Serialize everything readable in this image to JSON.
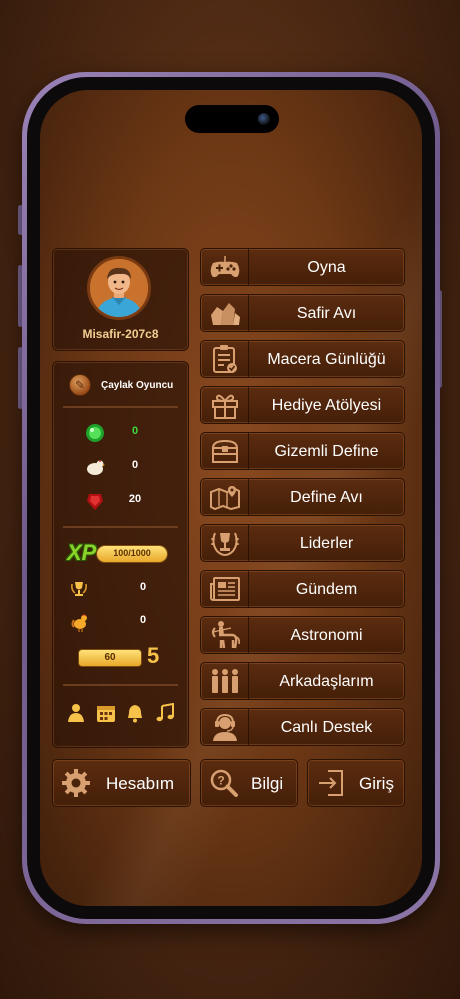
{
  "profile": {
    "username": "Misafir-207c8"
  },
  "stats": {
    "rank_label": "Çaylak Oyuncu",
    "resources": [
      {
        "icon": "green-gem-icon",
        "value": "0",
        "color": "#3ddc3d"
      },
      {
        "icon": "chicken-icon",
        "value": "0",
        "color": "#ffffff"
      },
      {
        "icon": "red-gem-icon",
        "value": "20",
        "color": "#ffffff"
      }
    ],
    "xp_label": "XP",
    "xp_text": "100/1000",
    "xp_progress": 0.1,
    "trophy_value": "0",
    "rooster_value": "0",
    "level_progress_text": "60",
    "level": "5"
  },
  "menu": [
    {
      "icon": "gamepad-icon",
      "label": "Oyna"
    },
    {
      "icon": "sapphire-rocks-icon",
      "label": "Safir Avı"
    },
    {
      "icon": "clipboard-icon",
      "label": "Macera Günlüğü"
    },
    {
      "icon": "gift-icon",
      "label": "Hediye Atölyesi"
    },
    {
      "icon": "treasure-chest-icon",
      "label": "Gizemli Define"
    },
    {
      "icon": "map-icon",
      "label": "Define Avı"
    },
    {
      "icon": "laurel-trophy-icon",
      "label": "Liderler"
    },
    {
      "icon": "newspaper-icon",
      "label": "Gündem"
    },
    {
      "icon": "centaur-archer-icon",
      "label": "Astronomi"
    },
    {
      "icon": "friends-icon",
      "label": "Arkadaşlarım"
    },
    {
      "icon": "headset-support-icon",
      "label": "Canlı Destek"
    }
  ],
  "bottom": {
    "account": "Hesabım",
    "info": "Bilgi",
    "login": "Giriş"
  },
  "colors": {
    "accent": "#f6c24a",
    "label": "#f3cf93"
  }
}
